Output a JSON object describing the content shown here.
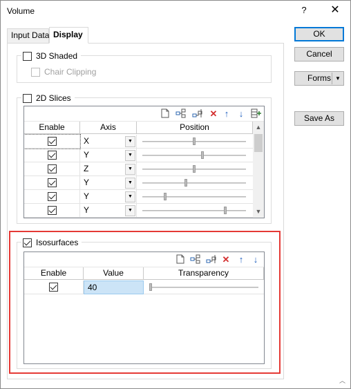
{
  "window": {
    "title": "Volume",
    "help": "?",
    "close": "✕"
  },
  "tabs": [
    {
      "label": "Input Data"
    },
    {
      "label": "Display"
    }
  ],
  "buttons": {
    "ok": "OK",
    "cancel": "Cancel",
    "forms": "Forms",
    "save_as": "Save As"
  },
  "shaded": {
    "label": "3D Shaded",
    "checked": false,
    "chair_clipping": {
      "label": "Chair Clipping",
      "checked": false
    }
  },
  "slices": {
    "label": "2D Slices",
    "checked": false,
    "columns": [
      "Enable",
      "Axis",
      "Position"
    ],
    "rows": [
      {
        "enable": true,
        "axis": "X",
        "position": 0.5
      },
      {
        "enable": true,
        "axis": "Y",
        "position": 0.58
      },
      {
        "enable": true,
        "axis": "Z",
        "position": 0.5
      },
      {
        "enable": true,
        "axis": "Y",
        "position": 0.42
      },
      {
        "enable": true,
        "axis": "Y",
        "position": 0.22
      },
      {
        "enable": true,
        "axis": "Y",
        "position": 0.8
      }
    ]
  },
  "isosurfaces": {
    "label": "Isosurfaces",
    "checked": true,
    "columns": [
      "Enable",
      "Value",
      "Transparency"
    ],
    "rows": [
      {
        "enable": true,
        "value": "40",
        "transparency": 0.0
      }
    ]
  },
  "toolbar_icons": [
    "new-icon",
    "insert-icon",
    "delete-row-icon",
    "delete-icon",
    "move-up-icon",
    "move-down-icon",
    "add-column-icon"
  ]
}
